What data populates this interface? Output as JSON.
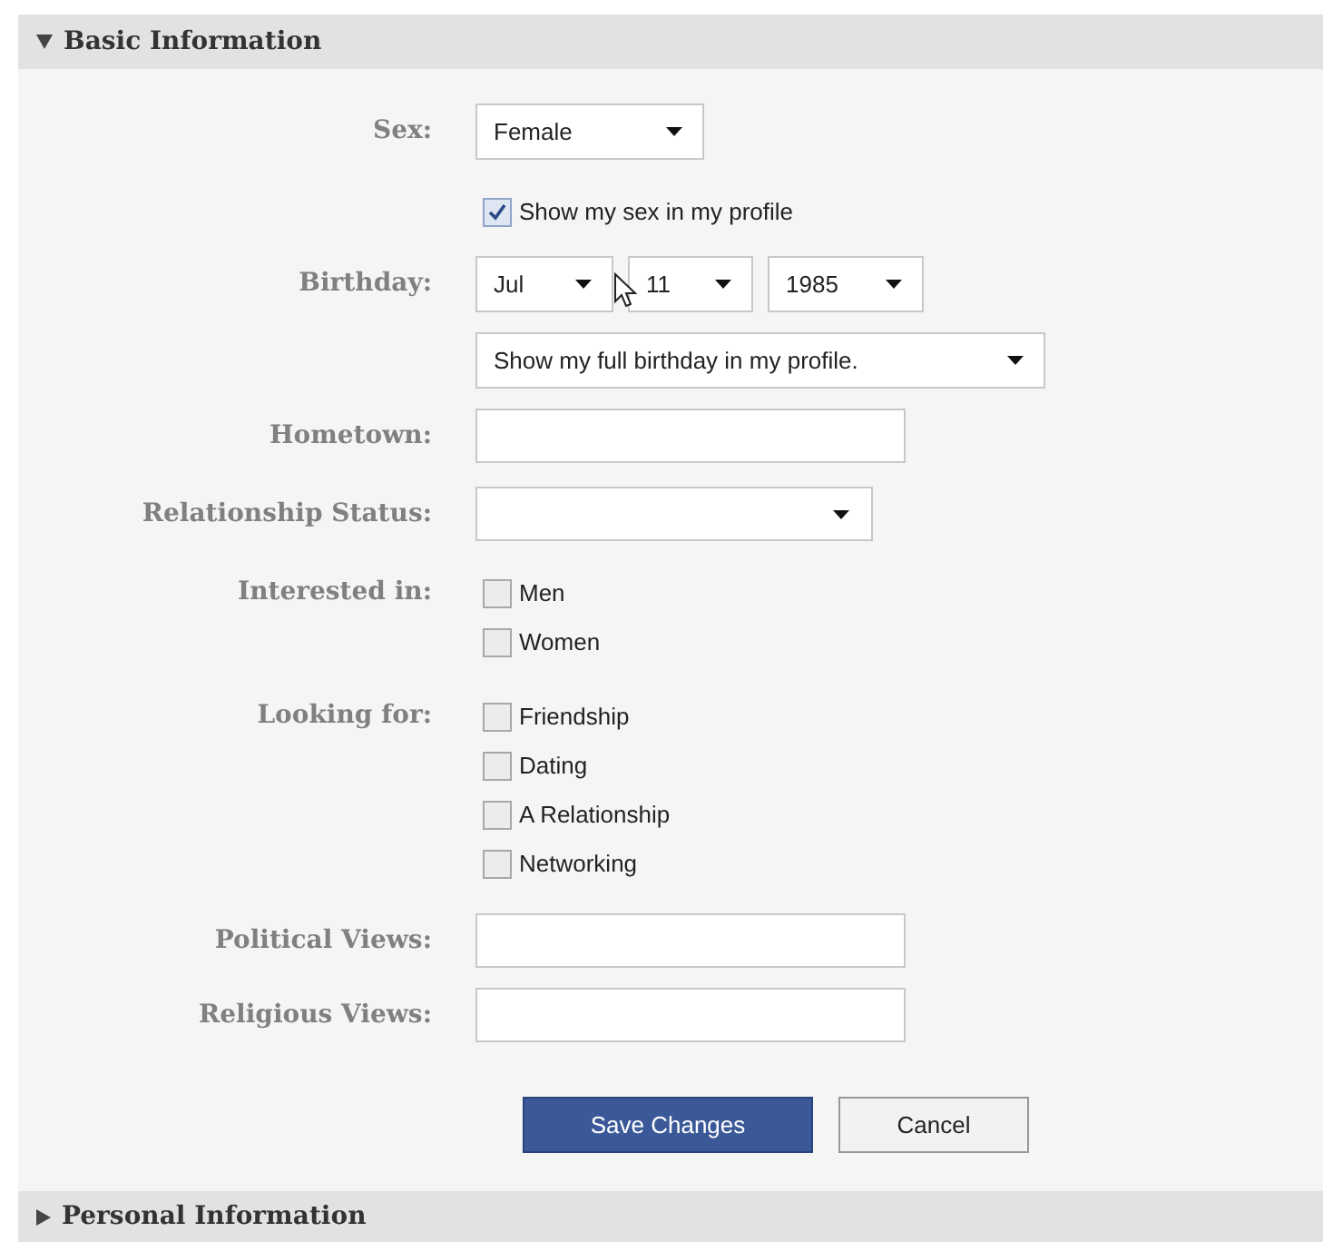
{
  "sections": [
    {
      "title": "Basic Information",
      "expanded": true
    },
    {
      "title": "Personal Information",
      "expanded": false
    }
  ],
  "fields": [
    {
      "label": "Sex:",
      "kind": "select",
      "selects": [
        {
          "value": "Female"
        }
      ]
    },
    {
      "kind": "checkbox",
      "options": [
        {
          "label": "Show my sex in my profile",
          "checked": true
        }
      ]
    },
    {
      "label": "Birthday:",
      "kind": "select",
      "selects": [
        {
          "value": "Jul"
        },
        {
          "value": "11"
        },
        {
          "value": "1985"
        }
      ]
    },
    {
      "kind": "select",
      "selects": [
        {
          "value": "Show my full birthday in my profile."
        }
      ]
    },
    {
      "label": "Hometown:",
      "kind": "text"
    },
    {
      "label": "Relationship Status:",
      "kind": "empty_select"
    },
    {
      "label": "Interested in:",
      "kind": "checkbox",
      "options": [
        {
          "label": "Men",
          "checked": false
        },
        {
          "label": "Women",
          "checked": false
        }
      ]
    },
    {
      "label": "Looking for:",
      "kind": "checkbox",
      "options": [
        {
          "label": "Friendship",
          "checked": false
        },
        {
          "label": "Dating",
          "checked": false
        },
        {
          "label": "A Relationship",
          "checked": false
        },
        {
          "label": "Networking",
          "checked": false
        }
      ]
    },
    {
      "label": "Political Views:",
      "kind": "text"
    },
    {
      "label": "Religious Views:",
      "kind": "text"
    }
  ],
  "buttons": [
    {
      "label": "Save Changes",
      "kind": "primary"
    },
    {
      "label": "Cancel",
      "kind": "secondary"
    }
  ]
}
